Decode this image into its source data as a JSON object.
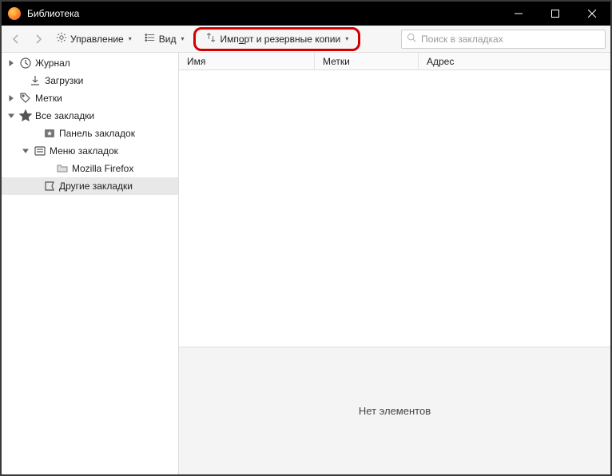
{
  "window": {
    "title": "Библиотека"
  },
  "toolbar": {
    "manage_label": "Управление",
    "view_label": "Вид",
    "import_label_pre": "Имп",
    "import_label_u": "о",
    "import_label_post": "рт и резервные копии"
  },
  "search": {
    "placeholder": "Поиск в закладках"
  },
  "sidebar": {
    "items": [
      {
        "label": "Журнал"
      },
      {
        "label": "Загрузки"
      },
      {
        "label": "Метки"
      },
      {
        "label": "Все закладки"
      },
      {
        "label": "Панель закладок"
      },
      {
        "label": "Меню закладок"
      },
      {
        "label": "Mozilla Firefox"
      },
      {
        "label": "Другие закладки"
      }
    ]
  },
  "columns": {
    "name": "Имя",
    "tags": "Метки",
    "address": "Адрес"
  },
  "details": {
    "empty": "Нет элементов"
  }
}
